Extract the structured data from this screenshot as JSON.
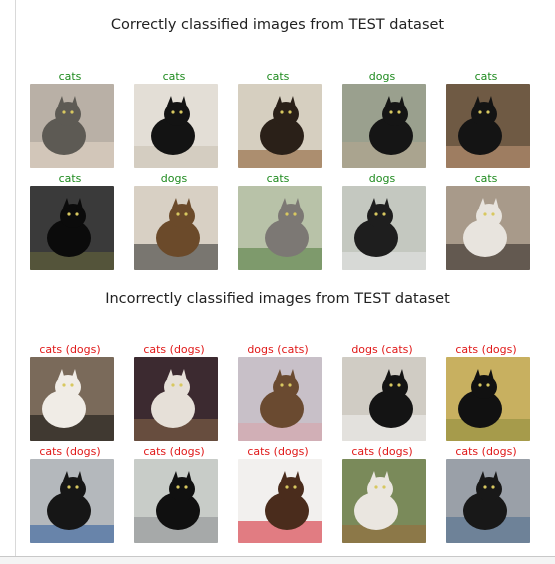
{
  "colors": {
    "correct_label": "#1e8a1e",
    "incorrect_label": "#e01818"
  },
  "sections": {
    "correct": {
      "title": "Correctly classified images from TEST dataset",
      "images": [
        {
          "label": "cats",
          "icon": "tabby-cat-held-photo",
          "bg": "#b9b0a6",
          "body": "#5d5a54",
          "accent": "#e8d8c8"
        },
        {
          "label": "cats",
          "icon": "black-cat-photo",
          "bg": "#e3ded6",
          "body": "#131313",
          "accent": "#c8c0b0"
        },
        {
          "label": "cats",
          "icon": "tortoiseshell-cat-photo",
          "bg": "#d6cfc0",
          "body": "#2a2018",
          "accent": "#8a5a2c"
        },
        {
          "label": "dogs",
          "icon": "black-puppy-on-gravel-photo",
          "bg": "#9aa08e",
          "body": "#151515",
          "accent": "#b8a890"
        },
        {
          "label": "cats",
          "icon": "black-kitten-held-photo",
          "bg": "#6f5a44",
          "body": "#141414",
          "accent": "#c49a7a"
        },
        {
          "label": "cats",
          "icon": "black-cat-closeup-photo",
          "bg": "#3a3a3a",
          "body": "#0b0b0b",
          "accent": "#6a6a3a"
        },
        {
          "label": "dogs",
          "icon": "shepherd-dog-indoors-photo",
          "bg": "#d8d0c4",
          "body": "#6b4a2a",
          "accent": "#2c2c2c"
        },
        {
          "label": "cats",
          "icon": "grey-cat-with-plant-photo",
          "bg": "#b8c2a8",
          "body": "#7c7874",
          "accent": "#4f7a3a"
        },
        {
          "label": "dogs",
          "icon": "dog-behind-fence-photo",
          "bg": "#c4c8c0",
          "body": "#1e1e1e",
          "accent": "#e8e8e8"
        },
        {
          "label": "cats",
          "icon": "calico-cat-photo",
          "bg": "#a89a8a",
          "body": "#e8e4de",
          "accent": "#2a2420"
        }
      ]
    },
    "incorrect": {
      "title": "Incorrectly classified images from TEST dataset",
      "images": [
        {
          "label": "cats (dogs)",
          "icon": "black-white-puppy-photo",
          "bg": "#7a6a5a",
          "body": "#f0ece6",
          "accent": "#111111"
        },
        {
          "label": "cats (dogs)",
          "icon": "beagle-on-lap-photo",
          "bg": "#3c2a30",
          "body": "#e6e0d8",
          "accent": "#8a6a4a"
        },
        {
          "label": "dogs (cats)",
          "icon": "tortoiseshell-cat-in-crate-photo",
          "bg": "#c8c0c8",
          "body": "#6a4a30",
          "accent": "#d8a0a8"
        },
        {
          "label": "dogs (cats)",
          "icon": "two-tuxedo-kittens-photo",
          "bg": "#d0ccc4",
          "body": "#141414",
          "accent": "#f2f2f2"
        },
        {
          "label": "cats (dogs)",
          "icon": "black-dog-on-grass-photo",
          "bg": "#c8b060",
          "body": "#111111",
          "accent": "#8a8a3a"
        },
        {
          "label": "cats (dogs)",
          "icon": "black-dog-on-leash-photo",
          "bg": "#b4b8bc",
          "body": "#161616",
          "accent": "#2a5a9a"
        },
        {
          "label": "cats (dogs)",
          "icon": "black-pug-by-cage-photo",
          "bg": "#c8ccc8",
          "body": "#101010",
          "accent": "#8a8c90"
        },
        {
          "label": "cats (dogs)",
          "icon": "small-dog-on-red-mat-photo",
          "bg": "#f2f0ee",
          "body": "#4a2c1c",
          "accent": "#d41e2a"
        },
        {
          "label": "cats (dogs)",
          "icon": "beagle-puppy-on-grass-photo",
          "bg": "#7a8a5a",
          "body": "#eae6e0",
          "accent": "#9a6a3a"
        },
        {
          "label": "cats (dogs)",
          "icon": "black-dog-in-room-photo",
          "bg": "#9aa0a8",
          "body": "#181818",
          "accent": "#4a6a8a"
        }
      ]
    }
  }
}
